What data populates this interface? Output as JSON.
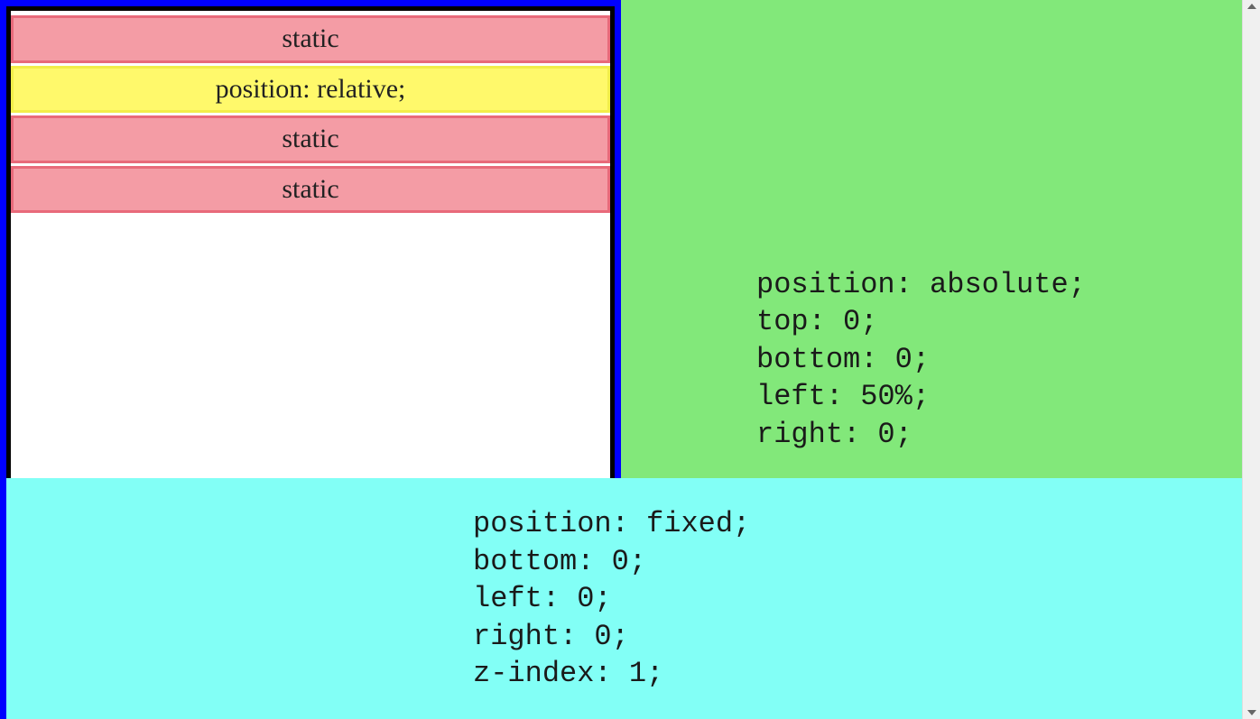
{
  "left_box": {
    "rows": [
      {
        "label": "static",
        "kind": "static"
      },
      {
        "label": "position: relative;",
        "kind": "relative"
      },
      {
        "label": "static",
        "kind": "static"
      },
      {
        "label": "static",
        "kind": "static"
      }
    ]
  },
  "green_panel": {
    "code": "position: absolute;\ntop: 0;\nbottom: 0;\nleft: 50%;\nright: 0;"
  },
  "cyan_panel": {
    "code": "position: fixed;\nbottom: 0;\nleft: 0;\nright: 0;\nz-index: 1;"
  },
  "colors": {
    "blue_border": "#0000ff",
    "black_border": "#000000",
    "static_fill": "#f49ca5",
    "static_border": "#e86a7a",
    "relative_fill": "#fff96b",
    "relative_border": "#f2ee4a",
    "green": "#82e87a",
    "cyan": "#82fff6"
  }
}
